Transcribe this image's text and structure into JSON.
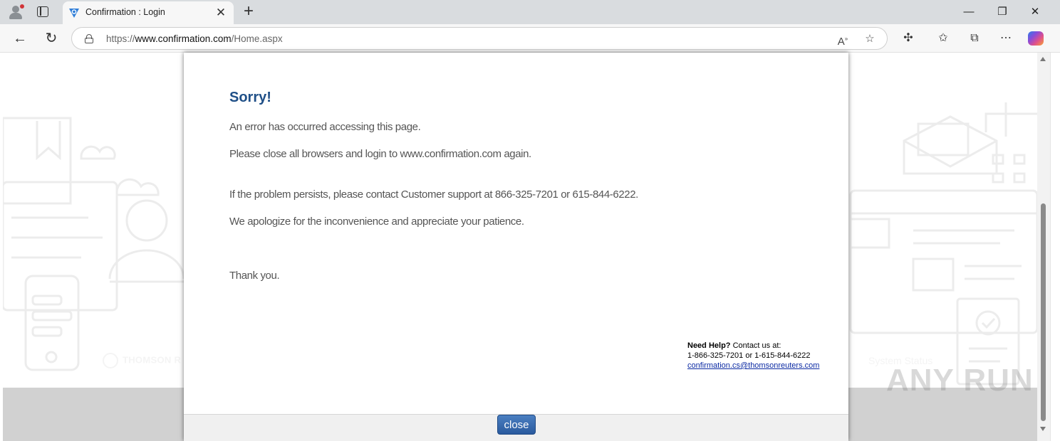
{
  "browser": {
    "tab_title": "Confirmation : Login",
    "url_prefix": "https://",
    "url_host": "www.confirmation.com",
    "url_path": "/Home.aspx"
  },
  "modal": {
    "heading": "Sorry!",
    "paragraphs": [
      "An error has occurred accessing this page.",
      "Please close all browsers and login to www.confirmation.com again.",
      "If the problem persists, please contact Customer support at 866-325-7201 or 615-844-6222.",
      "We apologize for the inconvenience and appreciate your patience.",
      "Thank you."
    ],
    "help": {
      "label": "Need Help?",
      "contact": "Contact us at:",
      "phones": "1-866-325-7201 or 1-615-844-6222",
      "email": "confirmation.cs@thomsonreuters.com"
    },
    "close_label": "close"
  },
  "footer": {
    "logo_text": "THOMSON R",
    "system_status": "System Status"
  },
  "watermark": "ANY RUN",
  "colors": {
    "heading": "#1f4f87",
    "button": "#2a5a9e",
    "link": "#0b2aa3"
  }
}
